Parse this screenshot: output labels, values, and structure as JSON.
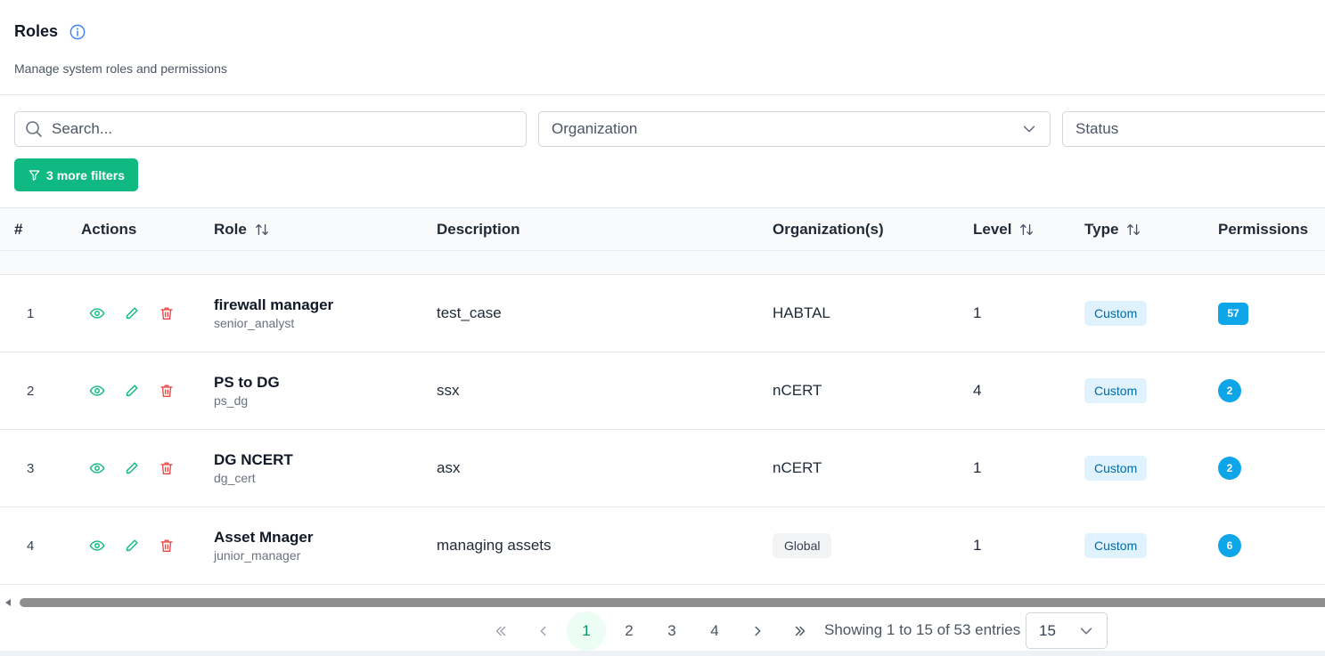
{
  "header": {
    "title": "Roles",
    "subtitle": "Manage system roles and permissions"
  },
  "filters": {
    "search_placeholder": "Search...",
    "organization_placeholder": "Organization",
    "status_placeholder": "Status",
    "more_filters_label": "3 more filters"
  },
  "table": {
    "columns": {
      "num": "#",
      "actions": "Actions",
      "role": "Role",
      "description": "Description",
      "organizations": "Organization(s)",
      "level": "Level",
      "type": "Type",
      "permissions": "Permissions"
    },
    "rows": [
      {
        "num": "1",
        "role_name": "firewall manager",
        "role_code": "senior_analyst",
        "description": "test_case",
        "organization": "HABTAL",
        "level": "1",
        "type": "Custom",
        "permissions": "57"
      },
      {
        "num": "2",
        "role_name": "PS to DG",
        "role_code": "ps_dg",
        "description": "ssx",
        "organization": "nCERT",
        "level": "4",
        "type": "Custom",
        "permissions": "2"
      },
      {
        "num": "3",
        "role_name": "DG NCERT",
        "role_code": "dg_cert",
        "description": "asx",
        "organization": "nCERT",
        "level": "1",
        "type": "Custom",
        "permissions": "2"
      },
      {
        "num": "4",
        "role_name": "Asset Mnager",
        "role_code": "junior_manager",
        "description": "managing assets",
        "organization": "Global",
        "level": "1",
        "type": "Custom",
        "permissions": "6"
      }
    ]
  },
  "pagination": {
    "pages": [
      "1",
      "2",
      "3",
      "4"
    ],
    "current_page": "1",
    "entries_text": "Showing 1 to 15 of 53 entries",
    "page_size": "15"
  },
  "colors": {
    "accent": "#10b981",
    "badge_blue": "#0ea5e9",
    "danger": "#ef4444"
  }
}
